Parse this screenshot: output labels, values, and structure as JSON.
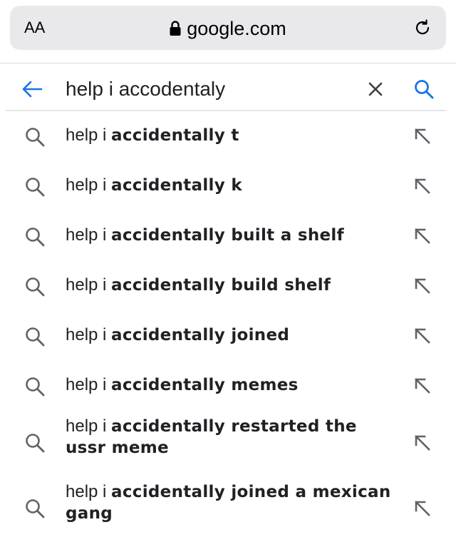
{
  "browser": {
    "reader_label": "AA",
    "domain": "google.com"
  },
  "search": {
    "query": "help i accodentaly"
  },
  "suggestions": [
    {
      "prefix": "help i ",
      "bold": "accidentally t"
    },
    {
      "prefix": "help i ",
      "bold": "accidentally k"
    },
    {
      "prefix": "help i ",
      "bold": "accidentally built a shelf"
    },
    {
      "prefix": "help i ",
      "bold": "accidentally build shelf"
    },
    {
      "prefix": "help i ",
      "bold": "accidentally joined"
    },
    {
      "prefix": "help i ",
      "bold": "accidentally memes"
    },
    {
      "prefix": "help i ",
      "bold": "accidentally restarted the ussr meme"
    },
    {
      "prefix": "help i ",
      "bold": "accidentally joined a mexican gang"
    }
  ],
  "icons": {
    "lock": "lock-icon",
    "reload": "reload-icon",
    "back": "back-arrow-icon",
    "clear": "close-icon",
    "search": "search-icon",
    "fill": "arrow-up-left-icon"
  },
  "colors": {
    "accent": "#1a73e8",
    "icon_gray": "#5f6368",
    "text": "#202124"
  }
}
